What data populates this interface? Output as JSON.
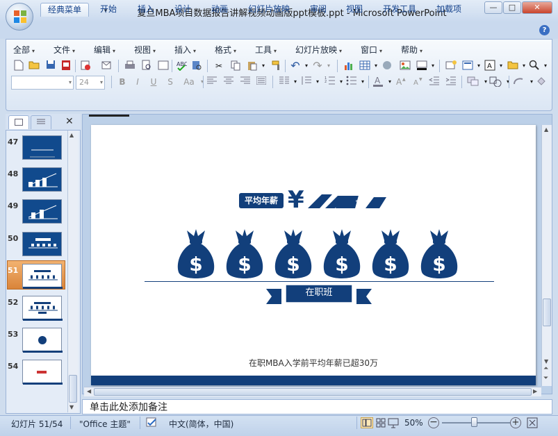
{
  "window": {
    "title": "复旦MBA项目数据报告讲解视频动画版ppt模板.ppt - Microsoft PowerPoint",
    "min": "—",
    "max": "□",
    "close": "✕"
  },
  "ribbon_tabs": [
    "经典菜单",
    "开始",
    "插入",
    "设计",
    "动画",
    "幻灯片放映",
    "审阅",
    "视图",
    "开发工具",
    "加载项"
  ],
  "help": "?",
  "menus": [
    "全部",
    "文件",
    "编辑",
    "视图",
    "插入",
    "格式",
    "工具",
    "幻灯片放映",
    "窗口",
    "帮助"
  ],
  "font_size_value": "24",
  "format_buttons": [
    "B",
    "I",
    "U",
    "S",
    "Aa"
  ],
  "panel": {
    "close": "✕",
    "slides": [
      "47",
      "48",
      "49",
      "50",
      "51",
      "52",
      "53",
      "54"
    ],
    "selected": "51"
  },
  "slide": {
    "badge": "平均年薪",
    "currency": "¥",
    "banner": "在职班",
    "caption": "在职MBA入学前平均年薪已超30万",
    "bag_symbol": "$",
    "primary_color": "#123f7b"
  },
  "notes": {
    "placeholder": "单击此处添加备注"
  },
  "status": {
    "slide_counter": "幻灯片 51/54",
    "theme": "\"Office 主题\"",
    "language": "中文(简体，中国)",
    "zoom": "50%",
    "zoom_level": 0.5
  }
}
